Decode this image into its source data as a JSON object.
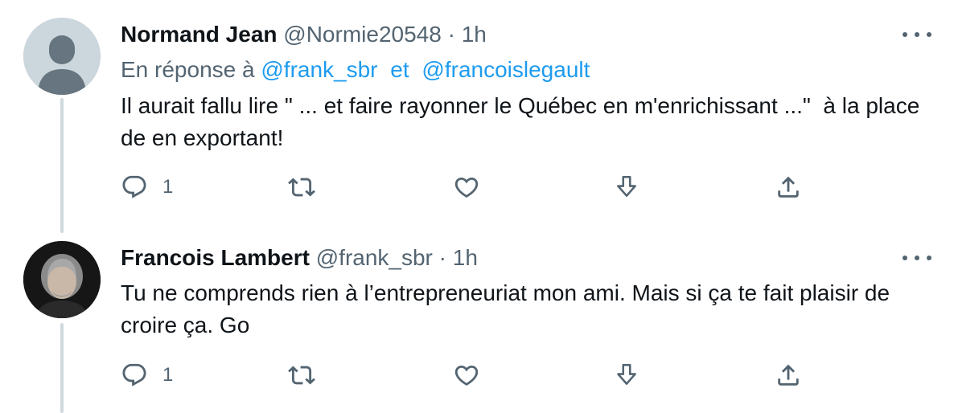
{
  "tweets": [
    {
      "author_name": "Normand Jean",
      "handle": "@Normie20548",
      "separator": "·",
      "time": "1h",
      "reply_prefix": "En réponse à",
      "reply_handle_1": "@frank_sbr",
      "reply_joiner": "et",
      "reply_handle_2": "@francoislegault",
      "text": "Il aurait fallu lire \" ... et faire rayonner le Québec en m'enrichissant ...\"  à la place de en exportant!",
      "reply_count": "1",
      "avatar": "default-profile-icon"
    },
    {
      "author_name": "Francois Lambert",
      "handle": "@frank_sbr",
      "separator": "·",
      "time": "1h",
      "text": "Tu ne comprends rien à l’entrepreneuriat mon ami. Mais si ça te fait plaisir de croire ça. Go",
      "reply_count": "1",
      "avatar": "profile-photo"
    }
  ],
  "icons": {
    "more": "more-icon",
    "reply": "reply-icon",
    "retweet": "retweet-icon",
    "like": "heart-icon",
    "bookmark": "download-arrow-icon",
    "share": "share-icon"
  },
  "colors": {
    "link": "#1d9bf0",
    "secondary_text": "#536471",
    "thread_line": "#cfd9de"
  }
}
